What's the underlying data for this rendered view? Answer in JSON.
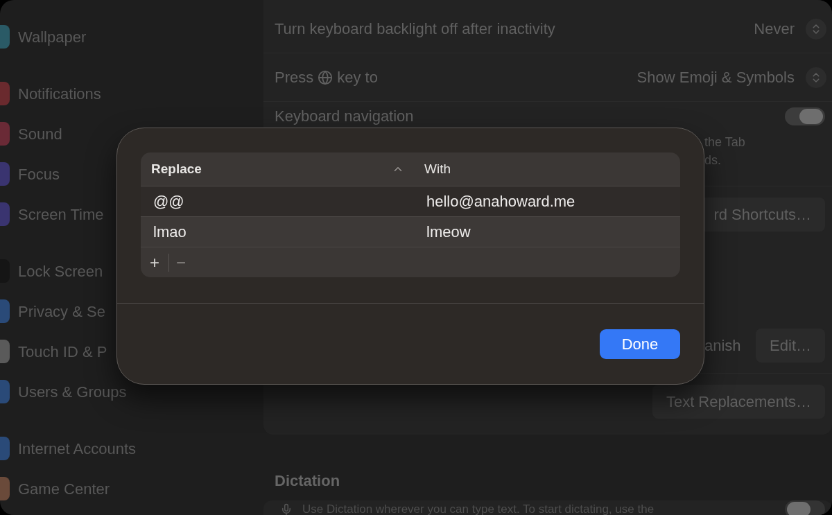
{
  "sidebar": {
    "groups": [
      {
        "items": [
          {
            "label": "Wallpaper",
            "color": "#2a5a66"
          }
        ]
      },
      {
        "items": [
          {
            "label": "Notifications",
            "color": "#6a2a2e"
          },
          {
            "label": "Sound",
            "color": "#6a2a36"
          },
          {
            "label": "Focus",
            "color": "#3a3470"
          },
          {
            "label": "Screen Time",
            "color": "#3a3470"
          }
        ]
      },
      {
        "items": [
          {
            "label": "Lock Screen",
            "color": "#151515"
          },
          {
            "label": "Privacy & Se",
            "color": "#2a4a78"
          },
          {
            "label": "Touch ID & P",
            "color": "#5a5a5a"
          },
          {
            "label": "Users & Groups",
            "color": "#2a4a78"
          }
        ]
      },
      {
        "items": [
          {
            "label": "Internet Accounts",
            "color": "#2a4a78"
          },
          {
            "label": "Game Center",
            "color": "#6a4a3a"
          }
        ]
      }
    ]
  },
  "settings": {
    "rows": [
      {
        "kind": "popup",
        "label": "Turn keyboard backlight off after inactivity",
        "value": "Never"
      },
      {
        "kind": "globe-popup",
        "label_before": "Press",
        "label_after": "key to",
        "value": "Show Emoji & Symbols"
      },
      {
        "kind": "toggle",
        "label": "Keyboard navigation",
        "on": true,
        "description": [
          "the Tab",
          "ds."
        ]
      },
      {
        "kind": "button",
        "button": "rd Shortcuts…"
      },
      {
        "kind": "spacer"
      },
      {
        "kind": "label-button",
        "label": "anish",
        "button": "Edit…"
      },
      {
        "kind": "button",
        "button": "Text Replacements…"
      }
    ],
    "dictation": {
      "heading": "Dictation",
      "text": "Use Dictation wherever you can type text. To start dictating, use the",
      "on": false
    }
  },
  "dialog": {
    "table": {
      "columns": [
        {
          "label": "Replace",
          "sorted": true
        },
        {
          "label": "With",
          "sorted": false
        }
      ],
      "rows": [
        [
          "@@",
          "hello@anahoward.me"
        ],
        [
          "lmao",
          "lmeow"
        ]
      ],
      "add": "+",
      "remove": "−"
    },
    "done": "Done"
  }
}
